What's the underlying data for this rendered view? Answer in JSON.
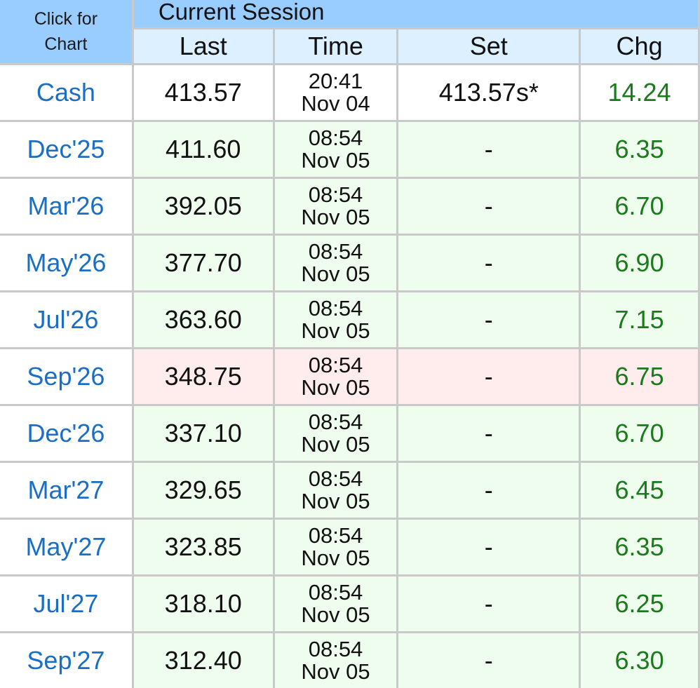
{
  "header": {
    "click_for_chart": "Click for Chart",
    "session_title": "Current Session",
    "columns": {
      "last": "Last",
      "time": "Time",
      "set": "Set",
      "chg": "Chg"
    }
  },
  "colors": {
    "header_blue": "#99ccff",
    "subheader_blue": "#dcf0ff",
    "link_blue": "#1a6fc4",
    "change_green": "#1b7a1b",
    "row_green": "#effdee",
    "row_red": "#ffeded"
  },
  "rows": [
    {
      "month": "Cash",
      "last": "413.57",
      "time": "20:41",
      "date": "Nov 04",
      "set": "413.57s*",
      "chg": "14.24",
      "tone": "cash"
    },
    {
      "month": "Dec'25",
      "last": "411.60",
      "time": "08:54",
      "date": "Nov 05",
      "set": "-",
      "chg": "6.35",
      "tone": "green"
    },
    {
      "month": "Mar'26",
      "last": "392.05",
      "time": "08:54",
      "date": "Nov 05",
      "set": "-",
      "chg": "6.70",
      "tone": "green"
    },
    {
      "month": "May'26",
      "last": "377.70",
      "time": "08:54",
      "date": "Nov 05",
      "set": "-",
      "chg": "6.90",
      "tone": "green"
    },
    {
      "month": "Jul'26",
      "last": "363.60",
      "time": "08:54",
      "date": "Nov 05",
      "set": "-",
      "chg": "7.15",
      "tone": "green"
    },
    {
      "month": "Sep'26",
      "last": "348.75",
      "time": "08:54",
      "date": "Nov 05",
      "set": "-",
      "chg": "6.75",
      "tone": "red"
    },
    {
      "month": "Dec'26",
      "last": "337.10",
      "time": "08:54",
      "date": "Nov 05",
      "set": "-",
      "chg": "6.70",
      "tone": "green"
    },
    {
      "month": "Mar'27",
      "last": "329.65",
      "time": "08:54",
      "date": "Nov 05",
      "set": "-",
      "chg": "6.45",
      "tone": "green"
    },
    {
      "month": "May'27",
      "last": "323.85",
      "time": "08:54",
      "date": "Nov 05",
      "set": "-",
      "chg": "6.35",
      "tone": "green"
    },
    {
      "month": "Jul'27",
      "last": "318.10",
      "time": "08:54",
      "date": "Nov 05",
      "set": "-",
      "chg": "6.25",
      "tone": "green"
    },
    {
      "month": "Sep'27",
      "last": "312.40",
      "time": "08:54",
      "date": "Nov 05",
      "set": "-",
      "chg": "6.30",
      "tone": "green"
    }
  ]
}
